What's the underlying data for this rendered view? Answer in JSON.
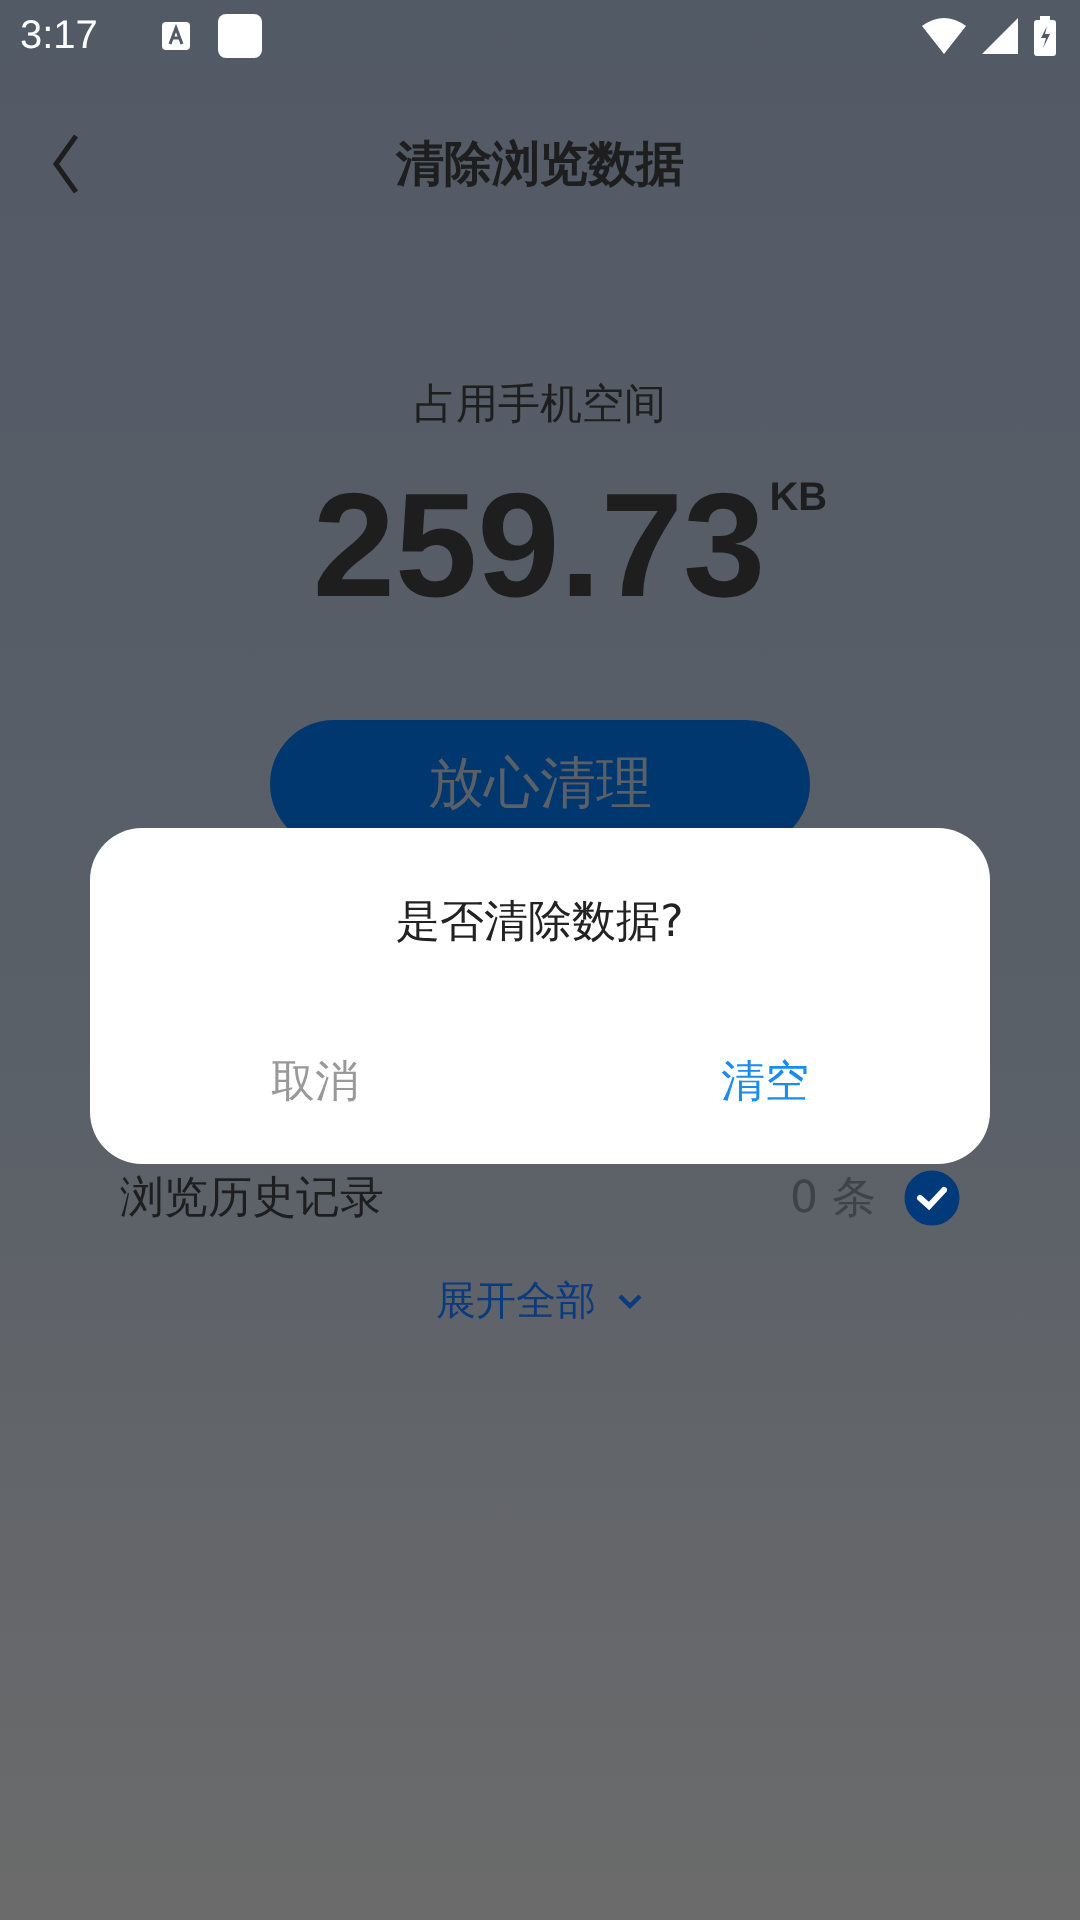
{
  "status_bar": {
    "time": "3:17"
  },
  "header": {
    "title": "清除浏览数据"
  },
  "storage": {
    "label": "占用手机空间",
    "value": "259.73",
    "unit": "KB"
  },
  "clean_button": {
    "label": "放心清理"
  },
  "items": [
    {
      "name": "浏览历史记录",
      "count": "0 条",
      "checked": true
    }
  ],
  "expand": {
    "label": "展开全部"
  },
  "dialog": {
    "message": "是否清除数据?",
    "buttons": [
      {
        "label": "取消",
        "kind": "cancel"
      },
      {
        "label": "清空",
        "kind": "confirm"
      }
    ]
  }
}
